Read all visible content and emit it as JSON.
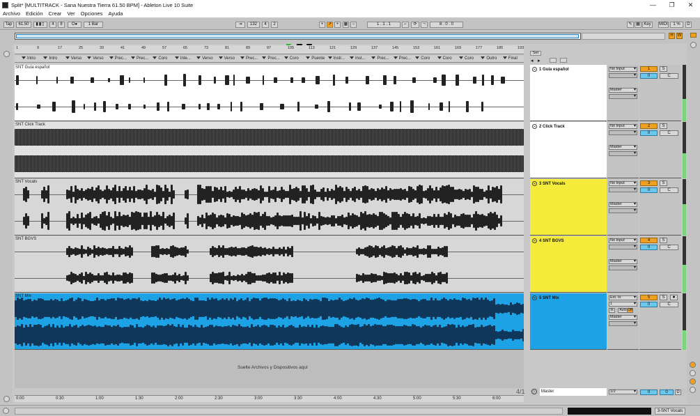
{
  "window": {
    "title": "Split*  [MULTITRACK - Sana Nuestra Tierra 61.50 BPM] - Ableton Live 10 Suite",
    "minimize": "—",
    "maximize": "❐",
    "close": "✕"
  },
  "menu": [
    "Archivo",
    "Edición",
    "Crear",
    "Ver",
    "Opciones",
    "Ayuda"
  ],
  "control": {
    "tap": "Tap",
    "tempo": "61.50",
    "sig_num": "4",
    "sig_den": "8",
    "metro": "O●",
    "quant": "1 Bar",
    "pos_bar": "132",
    "pos_beat": "4",
    "pos_sub": "2",
    "loop_start": "1 .  1 .  1",
    "loop_len": "8 .  0 .  0",
    "key": "Key",
    "midi": "MIDI",
    "cpu": "1 %",
    "disk": "D",
    "h": "H",
    "w": "W"
  },
  "ruler": [
    "1",
    "9",
    "17",
    "25",
    "33",
    "41",
    "49",
    "57",
    "65",
    "73",
    "81",
    "89",
    "97",
    "105",
    "113",
    "121",
    "129",
    "137",
    "145",
    "153",
    "161",
    "169",
    "177",
    "185",
    "193"
  ],
  "locators": [
    "Intro",
    "Intro",
    "Verso",
    "Verso",
    "Prec...",
    "Prec...",
    "Coro",
    "Inte...",
    "Verso",
    "Verso",
    "Prec...",
    "Prec...",
    "Coro",
    "Puente",
    "Instr...",
    "Inst...",
    "Prec...",
    "Prec...",
    "Coro",
    "Coro",
    "Coro",
    "Outro",
    "Final"
  ],
  "set_label": "Set",
  "tracks": [
    {
      "clip": "SNT Guía español",
      "name": "1 Guía español",
      "input": "No Input",
      "output": "Master",
      "num": "1",
      "pan": "0",
      "s": "S",
      "c": "C",
      "color": "#ffffff",
      "clipbg": "#ffffff",
      "meter": 0.4
    },
    {
      "clip": "SNT Click Track",
      "name": "2 Click Track",
      "input": "No Input",
      "output": "Master",
      "num": "2",
      "pan": "0",
      "s": "S",
      "c": "C",
      "color": "#ffffff",
      "clipbg": "#e2e2e2",
      "meter": 0.45
    },
    {
      "clip": "SNT Vocals",
      "name": "3 SNT Vocals",
      "input": "No Input",
      "output": "Master",
      "num": "3",
      "pan": "0",
      "s": "S",
      "c": "C",
      "color": "#f5eb3a",
      "clipbg": "#d7d7d7",
      "meter": 0.55
    },
    {
      "clip": "SNT BGVS",
      "name": "4 SNT BGVS",
      "input": "No Input",
      "output": "Master",
      "num": "4",
      "pan": "0",
      "s": "S",
      "c": "C",
      "color": "#f5eb3a",
      "clipbg": "#d7d7d7",
      "meter": 0.5
    },
    {
      "clip": "SNT Mix",
      "name": "5 SNT Mix",
      "input": "Ext. In",
      "input2": "1",
      "monitor": [
        "In",
        "Auto",
        "Off"
      ],
      "output": "Master",
      "num": "5",
      "pan": "0",
      "s": "S",
      "c": "C",
      "color": "#1ea2e6",
      "clipbg": "#1ea2e6",
      "meter": 0.35
    }
  ],
  "drop_text": "Suelte Archivos y Dispositivos aquí",
  "page_counter": "4/1",
  "time": [
    "0:00",
    "0:30",
    "1:00",
    "1:30",
    "2:00",
    "2:30",
    "3:00",
    "3:30",
    "4:00",
    "4:30",
    "5:00",
    "5:30",
    "6:00"
  ],
  "master": {
    "name": "Master",
    "output": "1/2",
    "vol": "0",
    "pan": "0",
    "d": "D"
  },
  "status": {
    "selected": "3-SNT Vocals"
  }
}
